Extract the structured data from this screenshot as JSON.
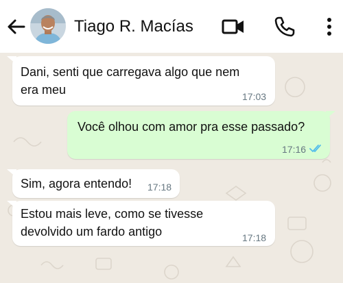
{
  "header": {
    "contact_name": "Tiago R. Macías"
  },
  "icons": {
    "back": "arrow-back-icon",
    "video": "video-camera-icon",
    "call": "phone-icon",
    "more": "more-vertical-icon"
  },
  "colors": {
    "chat_background": "#efeae2",
    "incoming_bubble": "#ffffff",
    "outgoing_bubble": "#d9fdd3",
    "read_ticks": "#53bdeb"
  },
  "messages": [
    {
      "direction": "in",
      "lines": [
        "Dani, senti que carregava algo que nem",
        "era meu"
      ],
      "time": "17:03"
    },
    {
      "direction": "out",
      "lines": [
        "Você olhou com amor pra esse passado?"
      ],
      "time": "17:16",
      "status": "read"
    },
    {
      "direction": "in",
      "lines": [
        "Sim, agora entendo!"
      ],
      "time": "17:18"
    },
    {
      "direction": "in",
      "lines": [
        "Estou mais leve, como se tivesse",
        "devolvido um fardo antigo"
      ],
      "time": "17:18"
    }
  ]
}
